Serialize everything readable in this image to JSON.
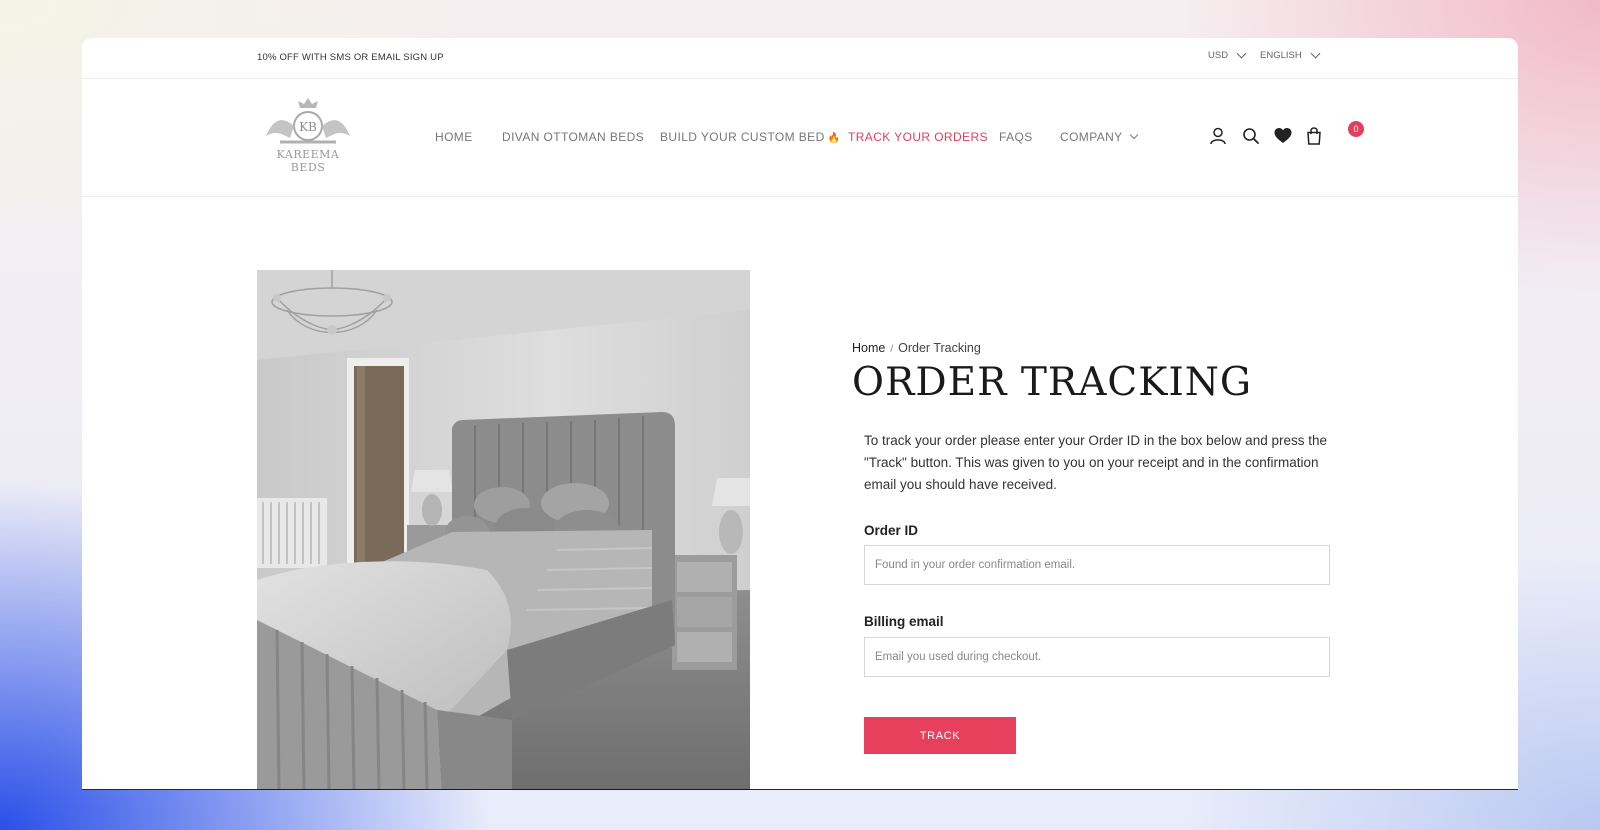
{
  "topbar": {
    "promo": "10% OFF WITH SMS OR EMAIL SIGN UP",
    "currency": "USD",
    "language": "ENGLISH"
  },
  "header": {
    "logo_monogram": "KB",
    "logo_text": "KAREEMA BEDS",
    "nav": [
      {
        "label": "HOME"
      },
      {
        "label": "DIVAN OTTOMAN BEDS"
      },
      {
        "label": "BUILD YOUR CUSTOM BED"
      },
      {
        "label": "TRACK YOUR ORDERS"
      },
      {
        "label": "FAQS"
      },
      {
        "label": "COMPANY"
      }
    ],
    "icons": [
      "account-icon",
      "search-icon",
      "heart-icon",
      "cart-icon"
    ],
    "cart_count": "0"
  },
  "breadcrumb": {
    "home": "Home",
    "separator": "/",
    "current": "Order Tracking"
  },
  "page": {
    "title": "ORDER TRACKING",
    "intro": "To track your order please enter your Order ID in the box below and press the \"Track\" button. This was given to you on your receipt and in the confirmation email you should have received."
  },
  "form": {
    "order_id_label": "Order ID",
    "order_id_placeholder": "Found in your order confirmation email.",
    "order_id_value": "",
    "email_label": "Billing email",
    "email_placeholder": "Email you used during checkout.",
    "email_value": "",
    "submit_label": "TRACK"
  },
  "colors": {
    "accent": "#e23f5d",
    "button": "#e6405c"
  }
}
